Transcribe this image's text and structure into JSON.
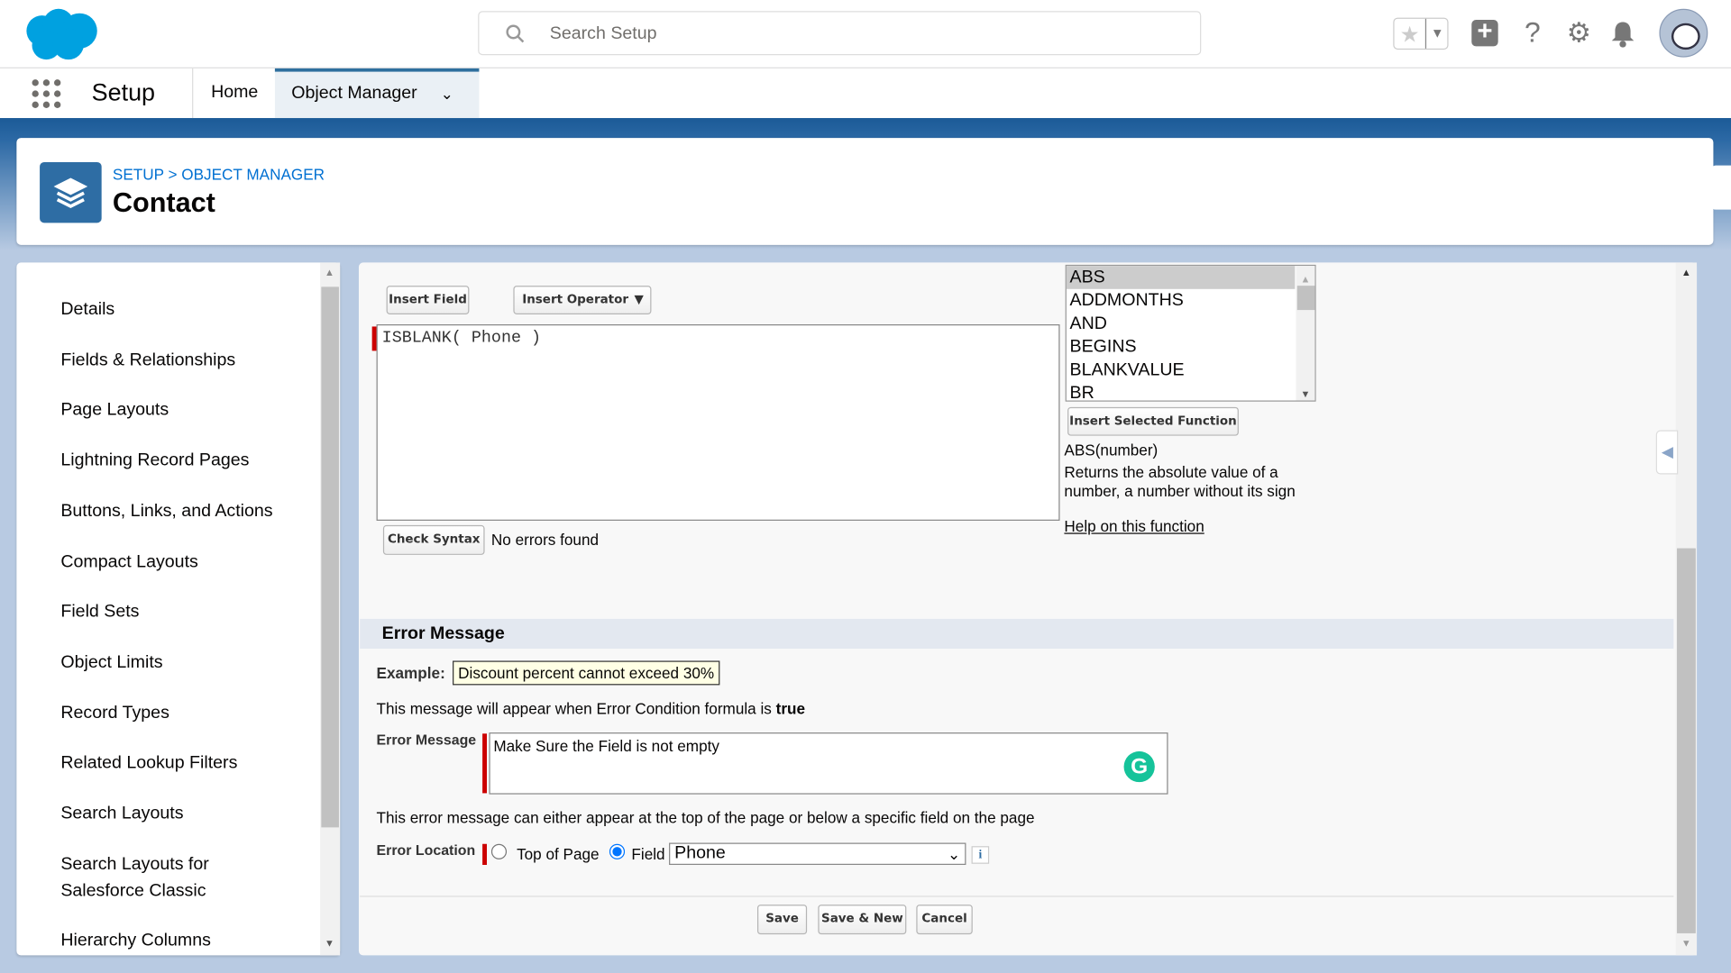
{
  "header": {
    "search_placeholder": "Search Setup"
  },
  "nav": {
    "app_name": "Setup",
    "tabs": [
      {
        "label": "Home"
      },
      {
        "label": "Object Manager"
      }
    ]
  },
  "page_header": {
    "breadcrumb": "SETUP > OBJECT MANAGER",
    "title": "Contact"
  },
  "sidebar": {
    "items": [
      "Details",
      "Fields & Relationships",
      "Page Layouts",
      "Lightning Record Pages",
      "Buttons, Links, and Actions",
      "Compact Layouts",
      "Field Sets",
      "Object Limits",
      "Record Types",
      "Related Lookup Filters",
      "Search Layouts",
      "Search Layouts for Salesforce Classic",
      "Hierarchy Columns"
    ]
  },
  "formula": {
    "insert_field": "Insert Field",
    "insert_operator": "Insert Operator",
    "value": "ISBLANK( Phone )",
    "functions": [
      "ABS",
      "ADDMONTHS",
      "AND",
      "BEGINS",
      "BLANKVALUE",
      "BR"
    ],
    "selected_function": "ABS",
    "insert_function": "Insert Selected Function",
    "signature": "ABS(number)",
    "description": "Returns the absolute value of a number, a number without its sign",
    "help_link": "Help on this function",
    "check_syntax": "Check Syntax",
    "syntax_status": "No errors found"
  },
  "error_message": {
    "section_title": "Error Message",
    "example_label": "Example:",
    "example_value": "Discount percent cannot exceed 30%",
    "note_prefix": "This message will appear when Error Condition formula is ",
    "note_bold": "true",
    "message_label": "Error Message",
    "message_value": "Make Sure the Field is not empty",
    "location_note": "This error message can either appear at the top of the page or below a specific field on the page",
    "location_label": "Error Location",
    "option_top": "Top of Page",
    "option_field": "Field",
    "selected_option": "Field",
    "field_value": "Phone"
  },
  "buttons": {
    "save": "Save",
    "save_new": "Save & New",
    "cancel": "Cancel"
  },
  "colors": {
    "brand": "#00a1e0",
    "accent": "#2e6da4",
    "required": "#cc0000"
  }
}
